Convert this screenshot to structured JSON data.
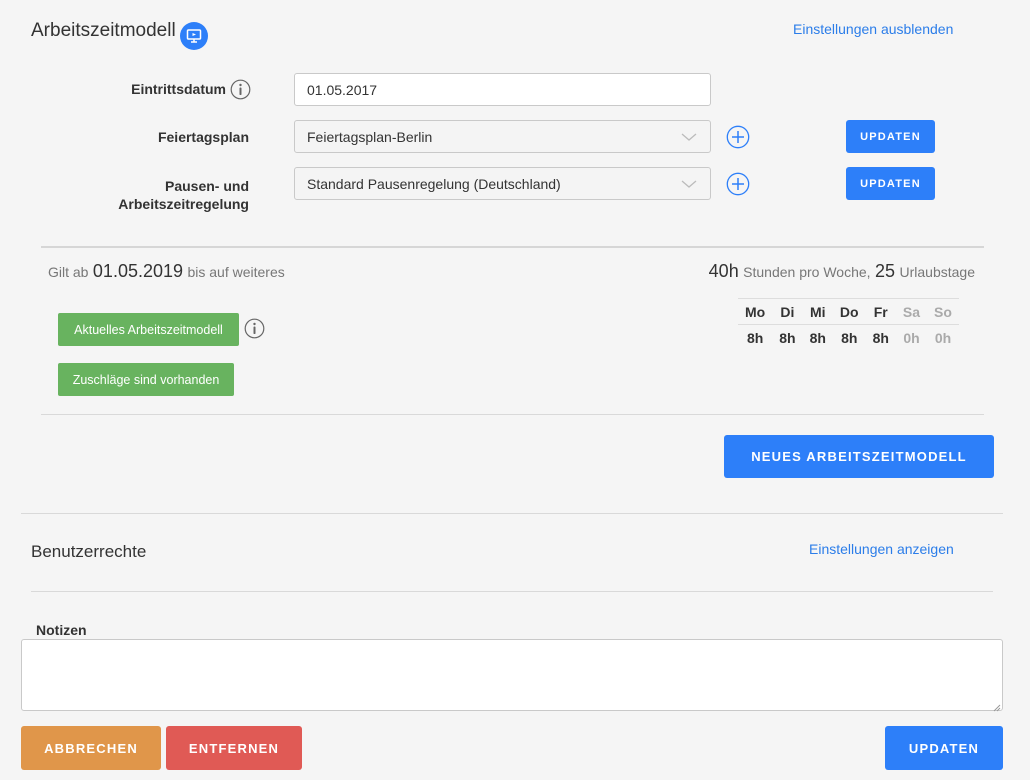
{
  "model": {
    "title": "Arbeitszeitmodell",
    "hide_settings_link": "Einstellungen ausblenden",
    "entry_date": {
      "label": "Eintrittsdatum",
      "value": "01.05.2017"
    },
    "holiday_plan": {
      "label": "Feiertagsplan",
      "value": "Feiertagsplan-Berlin",
      "update_label": "UPDATEN"
    },
    "break_rule": {
      "label_line1": "Pausen- und",
      "label_line2": "Arbeitszeitregelung",
      "value": "Standard Pausenregelung (Deutschland)",
      "update_label": "UPDATEN"
    },
    "period": {
      "prefix": "Gilt ab",
      "date": "01.05.2019",
      "suffix": "bis auf weiteres",
      "hours": "40h",
      "hours_text": "Stunden pro Woche,",
      "vacation": "25",
      "vacation_text": "Urlaubstage"
    },
    "current_model_label": "Aktuelles Arbeitszeitmodell",
    "surcharges_label": "Zuschläge sind vorhanden",
    "week": [
      {
        "day": "Mo",
        "hours": "8h"
      },
      {
        "day": "Di",
        "hours": "8h"
      },
      {
        "day": "Mi",
        "hours": "8h"
      },
      {
        "day": "Do",
        "hours": "8h"
      },
      {
        "day": "Fr",
        "hours": "8h"
      },
      {
        "day": "Sa",
        "hours": "0h"
      },
      {
        "day": "So",
        "hours": "0h"
      }
    ],
    "new_model_label": "NEUES ARBEITSZEITMODELL"
  },
  "rights": {
    "title": "Benutzerrechte",
    "show_settings_link": "Einstellungen anzeigen"
  },
  "notes": {
    "label": "Notizen",
    "value": ""
  },
  "footer": {
    "cancel_label": "ABBRECHEN",
    "remove_label": "ENTFERNEN",
    "update_label": "UPDATEN"
  },
  "colors": {
    "primary": "#2d7ff9",
    "success": "#68b35f",
    "warning": "#e0964a",
    "danger": "#e05a55",
    "link": "#2b7de9"
  },
  "icons": {
    "model_badge": "monitor-icon",
    "info": "info-icon",
    "add": "plus-icon",
    "dropdown": "chevron-down-icon"
  }
}
